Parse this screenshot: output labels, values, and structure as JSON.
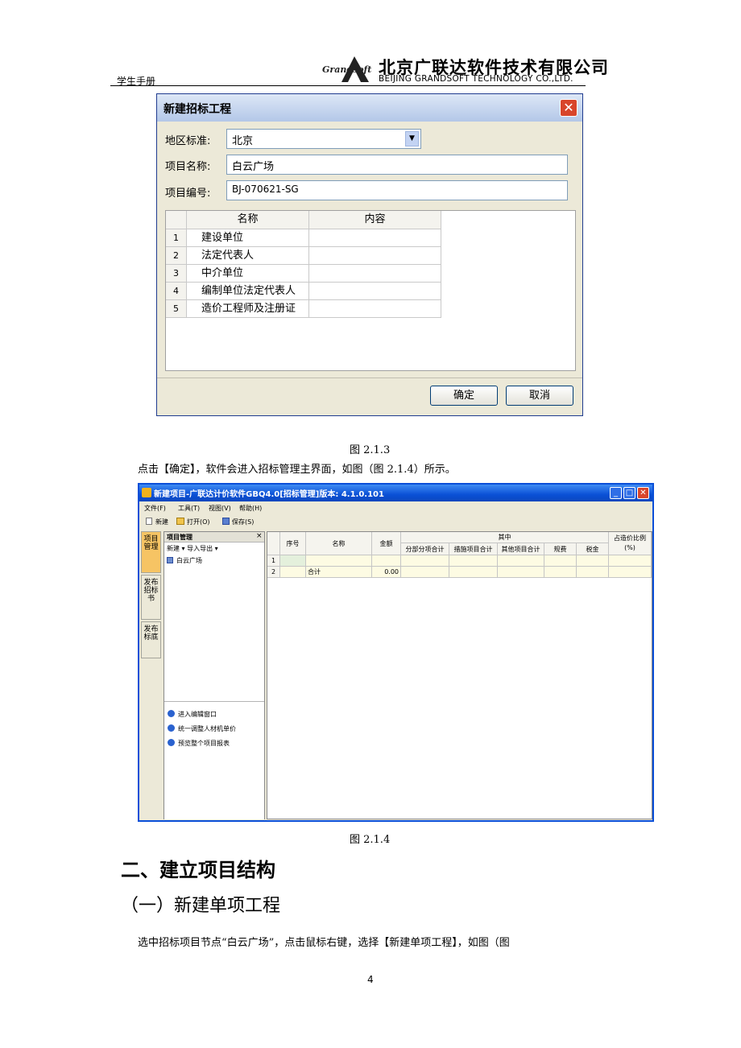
{
  "header": {
    "left_text": "学生手册",
    "logo_text": "Grandsoft",
    "company_cn": "北京广联达软件技术有限公司",
    "company_en": "BEIJING GRANDSOFT TECHNOLOGY CO.,LTD."
  },
  "dialog": {
    "title": "新建招标工程",
    "close_glyph": "✕",
    "region_label": "地区标准:",
    "region_value": "北京",
    "name_label": "项目名称:",
    "name_value": "白云广场",
    "code_label": "项目编号:",
    "code_value": "BJ-070621-SG",
    "grid_headers": [
      "名称",
      "内容"
    ],
    "rows": [
      {
        "num": "1",
        "name": "建设单位",
        "content": ""
      },
      {
        "num": "2",
        "name": "法定代表人",
        "content": ""
      },
      {
        "num": "3",
        "name": "中介单位",
        "content": ""
      },
      {
        "num": "4",
        "name": "编制单位法定代表人",
        "content": ""
      },
      {
        "num": "5",
        "name": "造价工程师及注册证",
        "content": ""
      }
    ],
    "ok_label": "确定",
    "cancel_label": "取消"
  },
  "caption1": "图 2.1.3",
  "paragraph1": "点击【确定】，软件会进入招标管理主界面，如图（图 2.1.4）所示。",
  "window": {
    "title": "新建项目-广联达计价软件GBQ4.0[招标管理]版本: 4.1.0.101",
    "menu": [
      "文件(F)",
      "工具(T)",
      "视图(V)",
      "帮助(H)"
    ],
    "toolbar": [
      "新建",
      "打开(O)",
      "保存(S)"
    ],
    "side_tabs": [
      "项目管理",
      "发布招标书",
      "发布标底"
    ],
    "panel_title": "项目管理",
    "panel_close": "×",
    "panel_toolbar": "新建 ▾  导入导出 ▾",
    "tree_item": "白云广场",
    "tasks": [
      "进入编辑窗口",
      "统一调整人材机单价",
      "预览整个项目报表"
    ],
    "table": {
      "headers": {
        "seq": "序号",
        "name": "名称",
        "amount": "金额",
        "group": "其中",
        "sub": [
          "分部分项合计",
          "措施项目合计",
          "其他项目合计",
          "规费",
          "税金"
        ],
        "ratio": "占造价比例(%)"
      },
      "rows": [
        {
          "num": "1",
          "seq": "",
          "name": "",
          "amount": ""
        },
        {
          "num": "2",
          "seq": "",
          "name": "合计",
          "amount": "0.00"
        }
      ]
    }
  },
  "caption2": "图 2.1.4",
  "heading2": "二、建立项目结构",
  "heading3": "（一）新建单项工程",
  "paragraph2": "选中招标项目节点“白云广场”，点击鼠标右键，选择【新建单项工程】，如图（图",
  "page_number": "4",
  "colors": {
    "title_blue": "#0a50d6",
    "dialog_bg": "#ece9d8",
    "close_red": "#d8452b"
  }
}
